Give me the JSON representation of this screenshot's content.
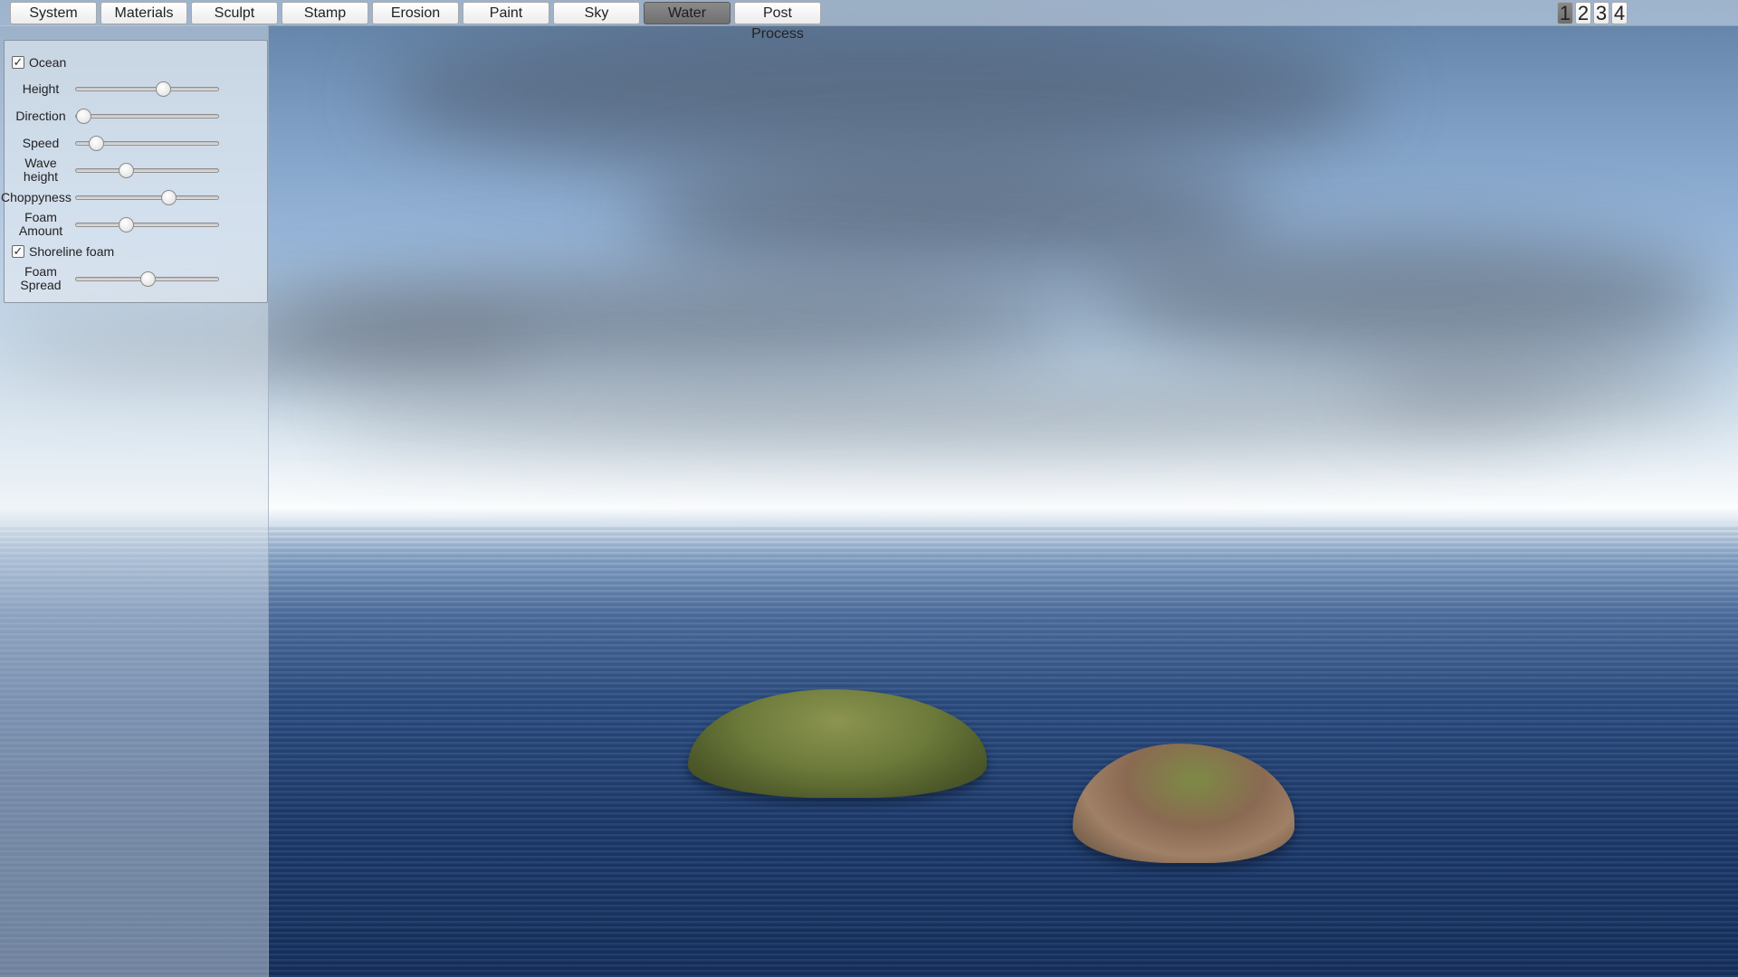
{
  "toolbar": {
    "tabs": [
      {
        "label": "System",
        "active": false
      },
      {
        "label": "Materials",
        "active": false
      },
      {
        "label": "Sculpt",
        "active": false
      },
      {
        "label": "Stamp",
        "active": false
      },
      {
        "label": "Erosion",
        "active": false
      },
      {
        "label": "Paint",
        "active": false
      },
      {
        "label": "Sky",
        "active": false
      },
      {
        "label": "Water",
        "active": true
      },
      {
        "label": "Post Process",
        "active": false
      }
    ],
    "view_buttons": [
      {
        "label": "1",
        "active": true
      },
      {
        "label": "2",
        "active": false
      },
      {
        "label": "3",
        "active": false
      },
      {
        "label": "4",
        "active": false
      }
    ]
  },
  "water_panel": {
    "ocean": {
      "label": "Ocean",
      "checked": true,
      "check_glyph": "✓"
    },
    "shoreline_foam": {
      "label": "Shoreline foam",
      "checked": true,
      "check_glyph": "✓"
    },
    "sliders": [
      {
        "label": "Height",
        "value": 0.61
      },
      {
        "label": "Direction",
        "value": 0.05
      },
      {
        "label": "Speed",
        "value": 0.14
      },
      {
        "label": "Wave height",
        "value": 0.35
      },
      {
        "label": "Choppyness",
        "value": 0.65
      },
      {
        "label": "Foam Amount",
        "value": 0.35
      },
      {
        "label": "Foam Spread",
        "value": 0.5
      }
    ]
  },
  "colors": {
    "active_tab": "#7a7a7a",
    "sky_top": "#5f7fa3",
    "horizon": "#fbfdfe",
    "ocean_deep": "#15305c",
    "island_green": "#6c7a3a",
    "island_rock": "#8a6a52"
  }
}
